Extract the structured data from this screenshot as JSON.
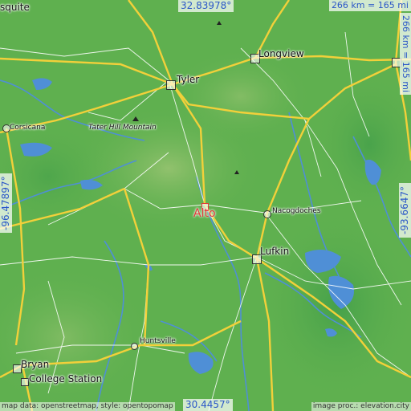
{
  "map": {
    "coords": {
      "top": "32.83978°",
      "bottom": "30.4457°",
      "left": "-96.47897°",
      "right": "-93.6647°"
    },
    "scale": {
      "horizontal": "266 km = 165 mi",
      "vertical": "266 km = 165 mi"
    },
    "target": {
      "name": "Alto",
      "color": "#e23a3a"
    },
    "places": [
      {
        "id": "squite",
        "name": "squite"
      },
      {
        "id": "longview",
        "name": "Longview"
      },
      {
        "id": "tyler",
        "name": "Tyler"
      },
      {
        "id": "corsicana",
        "name": "Corsicana"
      },
      {
        "id": "tater-hill",
        "name": "Tater Hill Mountain"
      },
      {
        "id": "nacogdoches",
        "name": "Nacogdoches"
      },
      {
        "id": "lufkin",
        "name": "Lufkin"
      },
      {
        "id": "huntsville",
        "name": "Huntsville"
      },
      {
        "id": "bryan",
        "name": "Bryan"
      },
      {
        "id": "college-station",
        "name": "College Station"
      }
    ],
    "credits": {
      "left": "map data: openstreetmap, style: opentopomap",
      "right": "image proc.: elevation.city"
    },
    "colors": {
      "land": "#5fb04f",
      "water": "#4f8fd6",
      "highway": "#f2d03a",
      "road": "#ffffff",
      "coord_text": "#2b57c8"
    }
  }
}
